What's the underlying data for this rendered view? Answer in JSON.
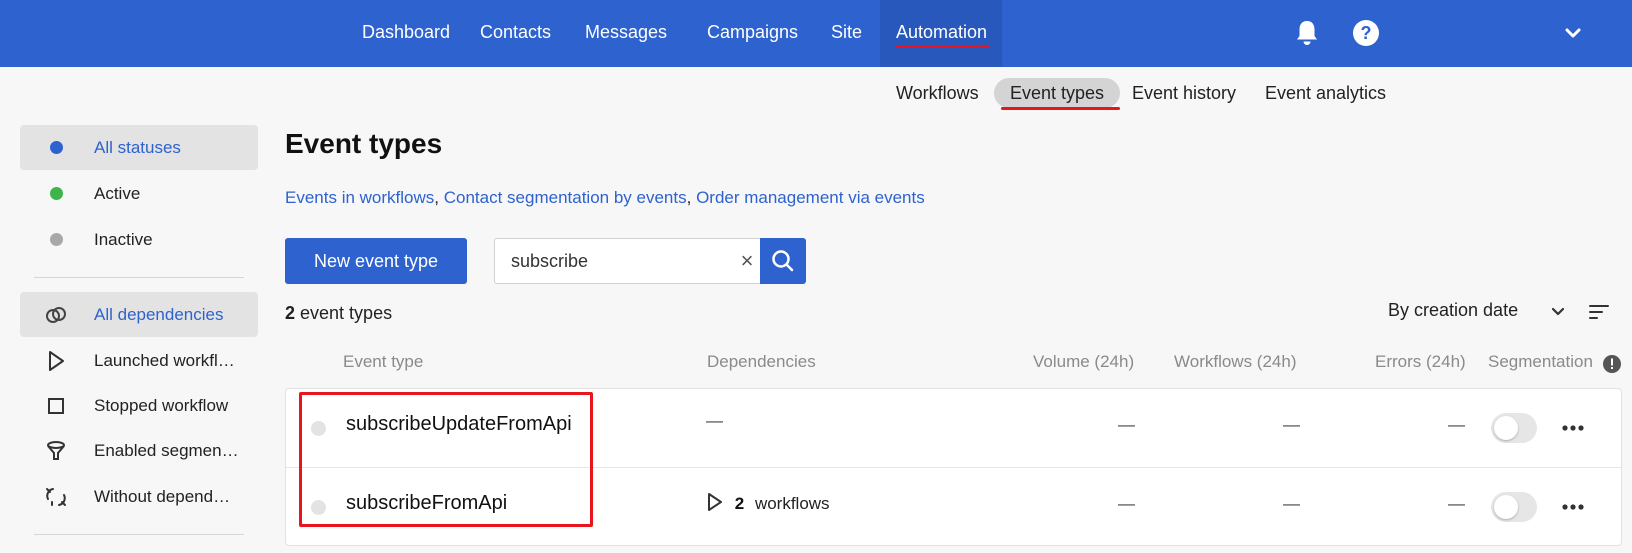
{
  "topnav": {
    "items": [
      {
        "label": "Dashboard"
      },
      {
        "label": "Contacts"
      },
      {
        "label": "Messages"
      },
      {
        "label": "Campaigns"
      },
      {
        "label": "Site"
      },
      {
        "label": "Automation",
        "active": true
      }
    ],
    "icons": [
      "bell-icon",
      "help-icon",
      "chevron-down-icon"
    ],
    "accent": "#2d62cf",
    "highlight": "#e8141e"
  },
  "subnav": {
    "items": [
      {
        "label": "Workflows"
      },
      {
        "label": "Event types",
        "active": true
      },
      {
        "label": "Event history"
      },
      {
        "label": "Event analytics"
      }
    ]
  },
  "sidebar": {
    "statuses": [
      {
        "label": "All statuses",
        "selected": true,
        "color": "#2d62cf"
      },
      {
        "label": "Active",
        "color": "#3db54a"
      },
      {
        "label": "Inactive",
        "color": "#a8a8a8"
      }
    ],
    "dependencies": [
      {
        "label": "All dependencies",
        "selected": true,
        "icon": "link-icon"
      },
      {
        "label": "Launched workfl…",
        "icon": "play-icon"
      },
      {
        "label": "Stopped workflow",
        "icon": "stop-icon"
      },
      {
        "label": "Enabled segmen…",
        "icon": "funnel-icon"
      },
      {
        "label": "Without depend…",
        "icon": "broken-link-icon"
      }
    ]
  },
  "main": {
    "title": "Event types",
    "help_links": [
      {
        "label": "Events in workflows"
      },
      {
        "label": "Contact segmentation by events"
      },
      {
        "label": "Order management via events"
      }
    ],
    "separator": ", ",
    "new_button": "New event type",
    "search": {
      "value": "subscribe",
      "clear": "×"
    },
    "count": "2",
    "count_suffix": " event types",
    "sort_label": "By creation date",
    "columns": {
      "event_type": "Event type",
      "dependencies": "Dependencies",
      "volume": "Volume (24h)",
      "workflows": "Workflows (24h)",
      "errors": "Errors (24h)",
      "segmentation": "Segmentation"
    },
    "rows": [
      {
        "name": "subscribeUpdateFromApi",
        "dependencies": "—",
        "volume": "—",
        "workflows": "—",
        "errors": "—",
        "segmentation": false
      },
      {
        "name": "subscribeFromApi",
        "dep_count": "2",
        "dep_label": "workflows",
        "volume": "—",
        "workflows": "—",
        "errors": "—",
        "segmentation": false
      }
    ]
  }
}
